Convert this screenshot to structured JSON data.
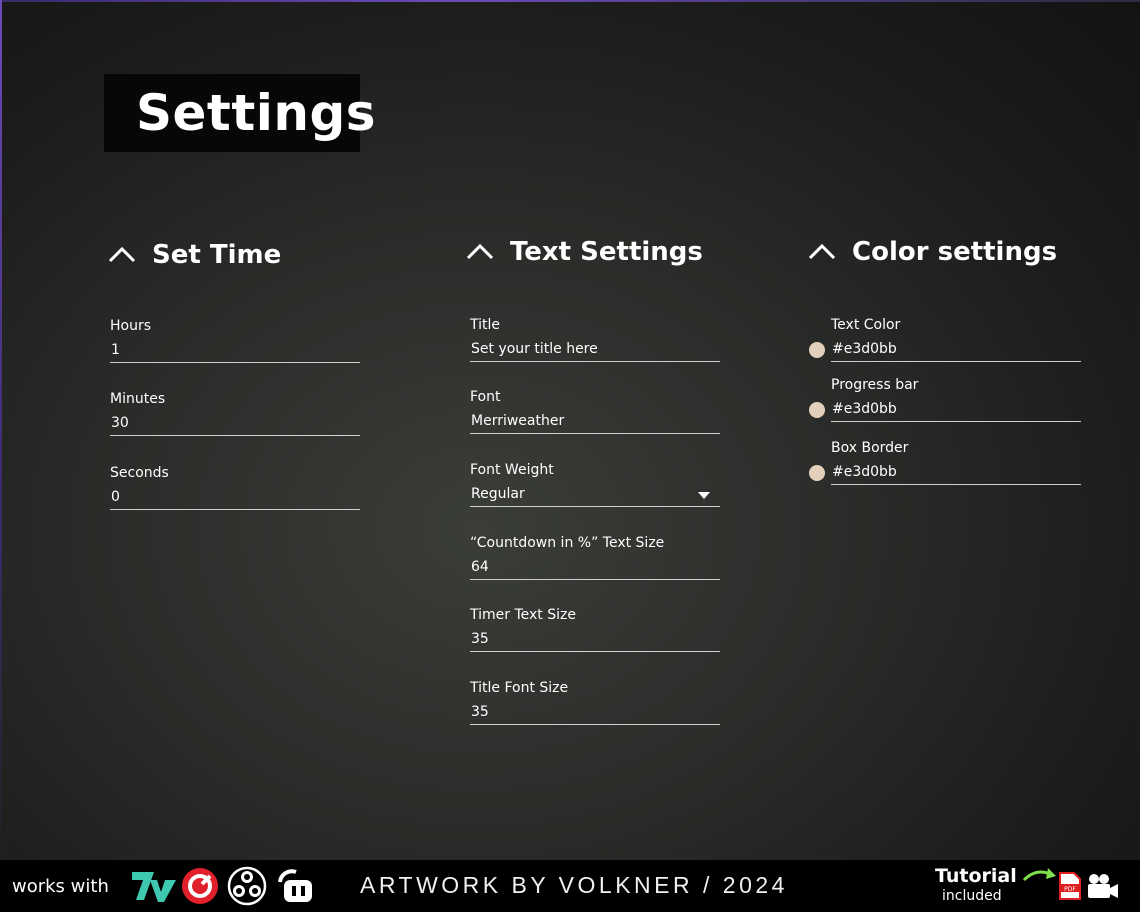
{
  "page": {
    "title": "Settings"
  },
  "sections": {
    "set_time": {
      "label": "Set Time",
      "fields": [
        {
          "label": "Hours",
          "value": "1"
        },
        {
          "label": "Minutes",
          "value": "30"
        },
        {
          "label": "Seconds",
          "value": "0"
        }
      ]
    },
    "text_settings": {
      "label": "Text Settings",
      "fields": [
        {
          "label": "Title",
          "value": "Set your title here"
        },
        {
          "label": "Font",
          "value": "Merriweather"
        },
        {
          "label": "Font Weight",
          "value": "Regular"
        },
        {
          "label": "“Countdown in %” Text Size",
          "value": "64"
        },
        {
          "label": "Timer Text Size",
          "value": "35"
        },
        {
          "label": "Title Font Size",
          "value": "35"
        }
      ]
    },
    "color_settings": {
      "label": "Color settings",
      "fields": [
        {
          "label": "Text Color",
          "value": "#e3d0bb",
          "color": "#e3d0bb"
        },
        {
          "label": "Progress bar",
          "value": "#e3d0bb",
          "color": "#e3d0bb"
        },
        {
          "label": "Box Border",
          "value": "#e3d0bb",
          "color": "#e3d0bb"
        }
      ]
    }
  },
  "footer": {
    "works_with": "works with",
    "logos": [
      "7tv-icon",
      "streamlabs-icon",
      "obs-icon",
      "streamer-bot-icon"
    ],
    "credit": "ARTWORK BY VOLKNER / 2024",
    "tutorial": "Tutorial",
    "included": "included",
    "tutorial_icons": [
      "arrow-icon",
      "pdf-icon",
      "video-camera-icon"
    ]
  },
  "colors": {
    "background": "#2b2d2a",
    "swatch": "#e3d0bb",
    "accent_green": "#3ec8b0",
    "pdf_red": "#e02020"
  }
}
